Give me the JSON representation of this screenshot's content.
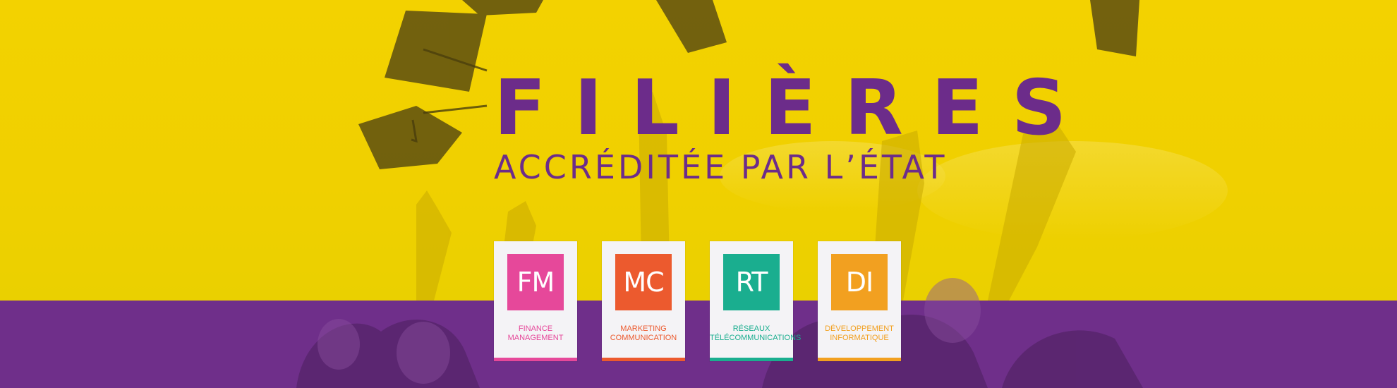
{
  "banner": {
    "title": "FILIÈRES",
    "subtitle": "ACCRÉDITÉE PAR L’ÉTAT",
    "colors": {
      "yellow": "#f3d400",
      "purple": "#6f2f8a",
      "title": "#6c2c8a"
    }
  },
  "programs": [
    {
      "code": "FM",
      "line1": "FINANCE",
      "line2": "MANAGEMENT",
      "color": "#e6489a"
    },
    {
      "code": "MC",
      "line1": "MARKETING",
      "line2": "COMMUNICATION",
      "color": "#ec5a2e"
    },
    {
      "code": "RT",
      "line1": "RÉSEAUX",
      "line2": "TÉLÉCOMMUNICATIONS",
      "color": "#1aae8f"
    },
    {
      "code": "DI",
      "line1": "DÉVELOPPEMENT",
      "line2": "INFORMATIQUE",
      "color": "#f2a020"
    }
  ]
}
